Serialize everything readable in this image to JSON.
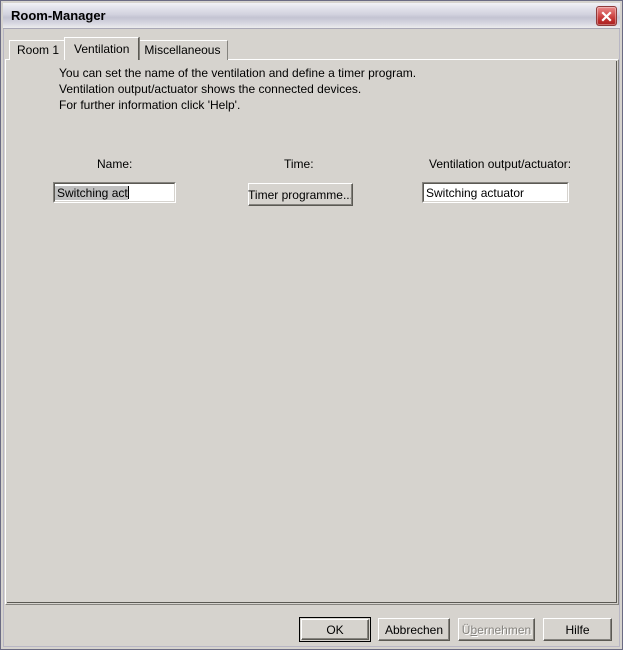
{
  "window": {
    "title": "Room-Manager",
    "close_icon": "close-icon"
  },
  "tabs": [
    {
      "label": "Room 1",
      "selected": false
    },
    {
      "label": "Ventilation",
      "selected": true
    },
    {
      "label": "Miscellaneous",
      "selected": false
    }
  ],
  "instructions": {
    "line1": "You can set the name of the ventilation and define a timer program.",
    "line2": "Ventilation output/actuator shows the connected devices.",
    "line3": "For further information click 'Help'."
  },
  "fields": {
    "name": {
      "label": "Name:",
      "value": "Switching act",
      "placeholder": ""
    },
    "time": {
      "label": "Time:",
      "button_label": "Timer programme..."
    },
    "ventilation_output": {
      "label": "Ventilation output/actuator:",
      "value": "Switching actuator",
      "placeholder": ""
    }
  },
  "footer": {
    "ok_label": "OK",
    "cancel_label": "Abbrechen",
    "apply_label_pre": "Ü",
    "apply_label_accel": "b",
    "apply_label_post": "ernehmen",
    "help_label": "Hilfe"
  },
  "colors": {
    "face": "#d6d3ce",
    "title_text": "#000000",
    "close_red": "#c03030",
    "selection_gray": "#c0c0c0",
    "disabled_text": "#85837e"
  }
}
